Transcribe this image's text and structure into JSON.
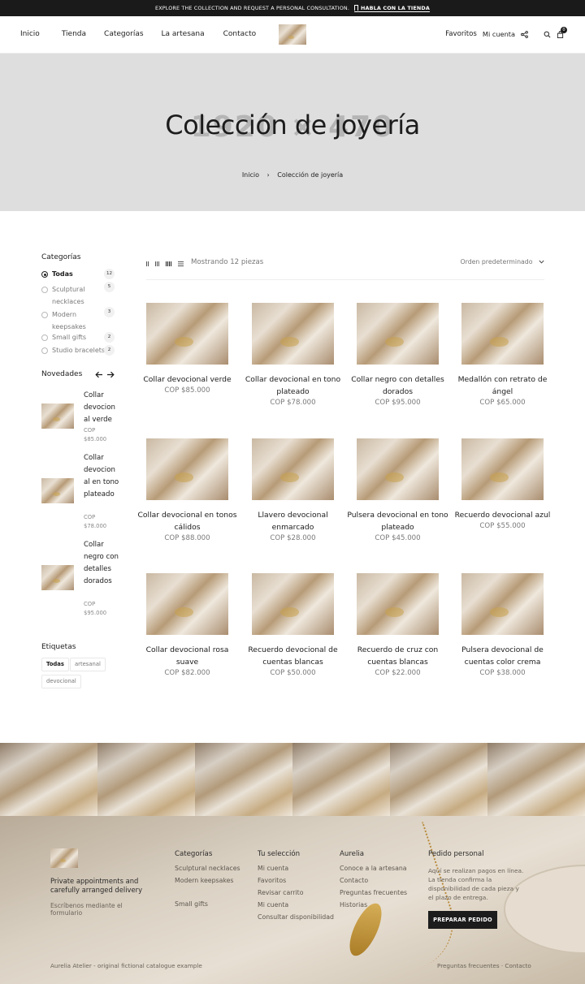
{
  "topbar": {
    "message": "EXPLORE THE COLLECTION AND REQUEST A PERSONAL CONSULTATION.",
    "link": "HABLA CON LA TIENDA"
  },
  "nav": {
    "items": [
      "Inicio",
      "Tienda",
      "Categorías",
      "La artesana",
      "Contacto"
    ]
  },
  "header_right": {
    "favorites": "Favoritos",
    "account": "Mi cuenta",
    "cart_count": "0"
  },
  "hero": {
    "bg_text": "1920 × 470",
    "title": "Colección de joyería",
    "breadcrumb_home": "Inicio",
    "breadcrumb_sep": "›",
    "breadcrumb_current": "Colección de joyería"
  },
  "sidebar": {
    "categories_title": "Categorías",
    "categories": [
      {
        "label": "Todas",
        "count": "12",
        "line2": ""
      },
      {
        "label": "Sculptural",
        "line2": "necklaces",
        "count": "5"
      },
      {
        "label": "Modern",
        "line2": "keepsakes",
        "count": "3"
      },
      {
        "label": "Small gifts",
        "count": "2",
        "line2": ""
      },
      {
        "label": "Studio bracelets",
        "count": "2",
        "line2": ""
      }
    ],
    "new_title": "Novedades",
    "new_items": [
      {
        "title": "Collar devocion al verde",
        "currency": "COP",
        "price": "$85.000"
      },
      {
        "title": "Collar devocion al en tono plateado",
        "currency": "COP",
        "price": "$78.000"
      },
      {
        "title": "Collar negro con detalles dorados",
        "currency": "COP",
        "price": "$95.000"
      }
    ],
    "tags_title": "Etiquetas",
    "tags": [
      "Todas",
      "artesanal",
      "devocional"
    ]
  },
  "toolbar": {
    "showing": "Mostrando 12 piezas",
    "sort": "Orden predeterminado"
  },
  "products": [
    {
      "name": "Collar devocional verde",
      "price": "COP $85.000"
    },
    {
      "name": "Collar devocional en tono plateado",
      "price": "COP $78.000"
    },
    {
      "name": "Collar negro con detalles dorados",
      "price": "COP $95.000"
    },
    {
      "name": "Medallón con retrato de ángel",
      "price": "COP $65.000"
    },
    {
      "name": "Collar devocional en tonos cálidos",
      "price": "COP $88.000"
    },
    {
      "name": "Llavero devocional enmarcado",
      "price": "COP $28.000"
    },
    {
      "name": "Pulsera devocional en tono plateado",
      "price": "COP $45.000"
    },
    {
      "name": "Recuerdo devocional azul",
      "price": "COP $55.000"
    },
    {
      "name": "Collar devocional rosa suave",
      "price": "COP $82.000"
    },
    {
      "name": "Recuerdo devocional de cuentas blancas",
      "price": "COP $50.000"
    },
    {
      "name": "Recuerdo de cruz con cuentas blancas",
      "price": "COP $22.000"
    },
    {
      "name": "Pulsera devocional de cuentas color crema",
      "price": "COP $38.000"
    }
  ],
  "footer": {
    "brand_text": "Private appointments and carefully arranged delivery",
    "brand_sub": "Escríbenos mediante el formulario",
    "col1_title": "Categorías",
    "col1_links": [
      "Sculptural necklaces",
      "Modern keepsakes",
      "Small gifts"
    ],
    "col2_title": "Tu selección",
    "col2_links": [
      "Mi cuenta",
      "Favoritos",
      "Revisar carrito",
      "Mi cuenta",
      "Consultar disponibilidad"
    ],
    "col3_title": "Aurelia",
    "col3_links": [
      "Conoce a la artesana",
      "Contacto",
      "Preguntas frecuentes",
      "Historias"
    ],
    "col4_title": "Pedido personal",
    "col4_text": "Aquí se realizan pagos en línea. La tienda confirma la disponibilidad de cada pieza y el plazo de entrega.",
    "button": "PREPARAR PEDIDO",
    "bottom_left": "Aurelia Atelier - original fictional catalogue example",
    "bottom_right": "Preguntas frecuentes  ·  Contacto"
  }
}
